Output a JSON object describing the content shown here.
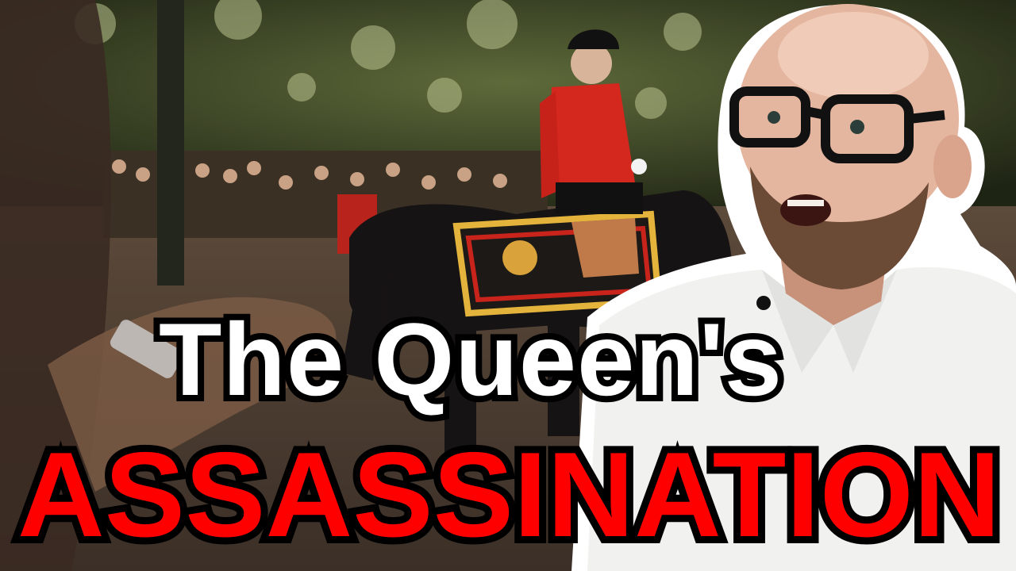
{
  "thumbnail": {
    "title_line_1": "The Queen's",
    "title_line_2": "ASSASSINATION"
  },
  "colors": {
    "title_line_1": "#ffffff",
    "title_line_2": "#ff0000",
    "text_outline": "#000000",
    "presenter_outline": "#ffffff"
  },
  "scene": {
    "background": "parade photo: rider in red tunic on black horse, crowd and trees",
    "foreground": "bald bearded presenter with black-rimmed glasses and white shirt"
  }
}
